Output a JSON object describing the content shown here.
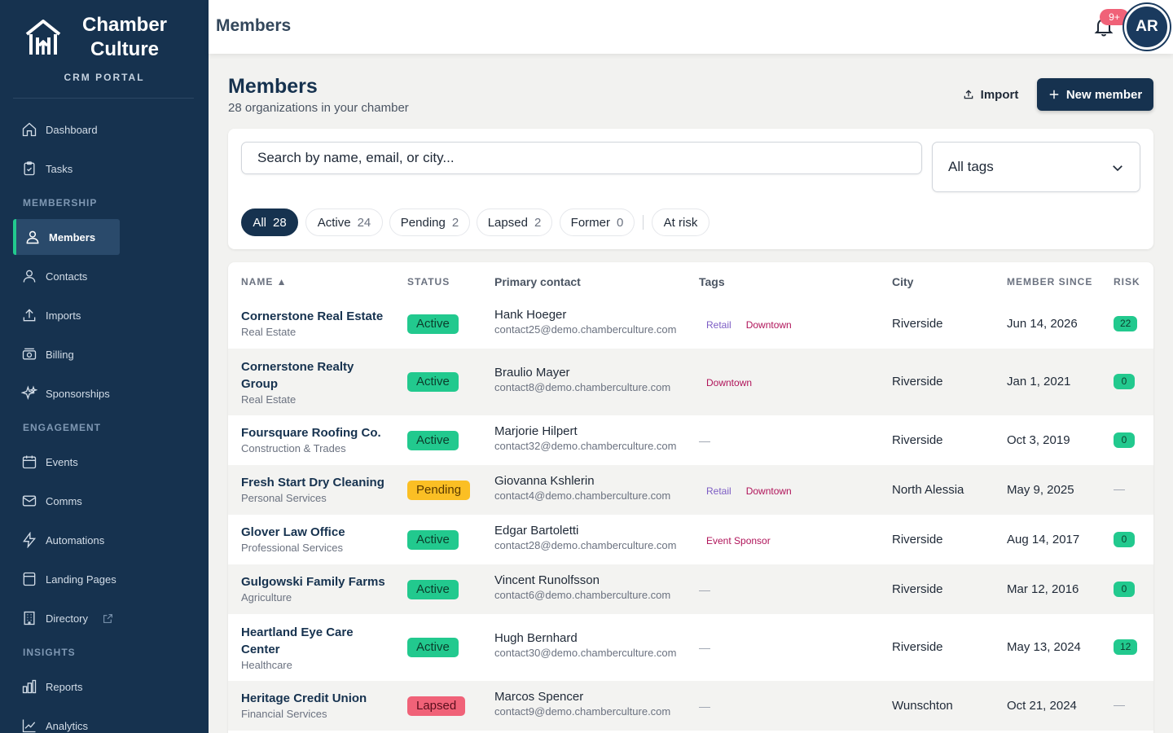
{
  "brand": {
    "name": "Chamber Culture",
    "subtitle": "CRM PORTAL"
  },
  "sidebar": {
    "items_top": [
      {
        "label": "Dashboard",
        "icon": "home-icon"
      },
      {
        "label": "Tasks",
        "icon": "clipboard-icon"
      }
    ],
    "section_membership": "MEMBERSHIP",
    "items_membership": [
      {
        "label": "Members",
        "icon": "users-icon",
        "active": true
      },
      {
        "label": "Contacts",
        "icon": "user-icon"
      },
      {
        "label": "Imports",
        "icon": "upload-icon"
      },
      {
        "label": "Billing",
        "icon": "cash-icon"
      },
      {
        "label": "Sponsorships",
        "icon": "sparkles-icon"
      }
    ],
    "section_engagement": "ENGAGEMENT",
    "items_engagement": [
      {
        "label": "Events",
        "icon": "calendar-icon"
      },
      {
        "label": "Comms",
        "icon": "mail-icon"
      },
      {
        "label": "Automations",
        "icon": "bolt-icon"
      },
      {
        "label": "Landing Pages",
        "icon": "page-icon"
      },
      {
        "label": "Directory",
        "icon": "building-icon"
      }
    ],
    "section_insights": "INSIGHTS",
    "items_insights": [
      {
        "label": "Reports",
        "icon": "bar-chart-icon"
      },
      {
        "label": "Analytics",
        "icon": "line-chart-icon"
      }
    ]
  },
  "header": {
    "title": "Members",
    "notification_count": "9+",
    "avatar_initials": "AR"
  },
  "page": {
    "title": "Members",
    "subtitle": "28 organizations in your chamber",
    "import_label": "Import",
    "new_member_label": "New member"
  },
  "filters": {
    "search_placeholder": "Search by name, email, or city...",
    "tags_selected": "All tags",
    "pills": [
      {
        "label": "All",
        "count": "28",
        "active": true
      },
      {
        "label": "Active",
        "count": "24"
      },
      {
        "label": "Pending",
        "count": "2"
      },
      {
        "label": "Lapsed",
        "count": "2"
      },
      {
        "label": "Former",
        "count": "0"
      },
      {
        "label": "At risk",
        "count": ""
      }
    ]
  },
  "table": {
    "columns": {
      "name": "NAME ▲",
      "status": "STATUS",
      "contact": "Primary contact",
      "tags": "Tags",
      "city": "City",
      "since": "MEMBER SINCE",
      "risk": "RISK"
    },
    "rows": [
      {
        "name": "Cornerstone Real Estate",
        "industry": "Real Estate",
        "status": "Active",
        "contact": "Hank Hoeger",
        "email": "contact25@demo.chamberculture.com",
        "tags": [
          "Retail",
          "Downtown"
        ],
        "city": "Riverside",
        "since": "Jun 14, 2026",
        "risk": "22"
      },
      {
        "name": "Cornerstone Realty Group",
        "industry": "Real Estate",
        "status": "Active",
        "contact": "Braulio Mayer",
        "email": "contact8@demo.chamberculture.com",
        "tags": [
          "Downtown"
        ],
        "city": "Riverside",
        "since": "Jan 1, 2021",
        "risk": "0"
      },
      {
        "name": "Foursquare Roofing Co.",
        "industry": "Construction & Trades",
        "status": "Active",
        "contact": "Marjorie Hilpert",
        "email": "contact32@demo.chamberculture.com",
        "tags": [],
        "city": "Riverside",
        "since": "Oct 3, 2019",
        "risk": "0"
      },
      {
        "name": "Fresh Start Dry Cleaning",
        "industry": "Personal Services",
        "status": "Pending",
        "contact": "Giovanna Kshlerin",
        "email": "contact4@demo.chamberculture.com",
        "tags": [
          "Retail",
          "Downtown"
        ],
        "city": "North Alessia",
        "since": "May 9, 2025",
        "risk": ""
      },
      {
        "name": "Glover Law Office",
        "industry": "Professional Services",
        "status": "Active",
        "contact": "Edgar Bartoletti",
        "email": "contact28@demo.chamberculture.com",
        "tags": [
          "Event Sponsor"
        ],
        "city": "Riverside",
        "since": "Aug 14, 2017",
        "risk": "0"
      },
      {
        "name": "Gulgowski Family Farms",
        "industry": "Agriculture",
        "status": "Active",
        "contact": "Vincent Runolfsson",
        "email": "contact6@demo.chamberculture.com",
        "tags": [],
        "city": "Riverside",
        "since": "Mar 12, 2016",
        "risk": "0"
      },
      {
        "name": "Heartland Eye Care Center",
        "industry": "Healthcare",
        "status": "Active",
        "contact": "Hugh Bernhard",
        "email": "contact30@demo.chamberculture.com",
        "tags": [],
        "city": "Riverside",
        "since": "May 13, 2024",
        "risk": "12"
      },
      {
        "name": "Heritage Credit Union",
        "industry": "Financial Services",
        "status": "Lapsed",
        "contact": "Marcos Spencer",
        "email": "contact9@demo.chamberculture.com",
        "tags": [],
        "city": "Wunschton",
        "since": "Oct 21, 2024",
        "risk": ""
      }
    ],
    "empty_mark": "—"
  },
  "colors": {
    "sidebar_bg": "#16324f",
    "accent_green": "#22c98e",
    "pending_yellow": "#fbbf24",
    "lapsed_red": "#f06278",
    "tag_purple": "#7c5cc4",
    "tag_pink": "#b0145a"
  }
}
